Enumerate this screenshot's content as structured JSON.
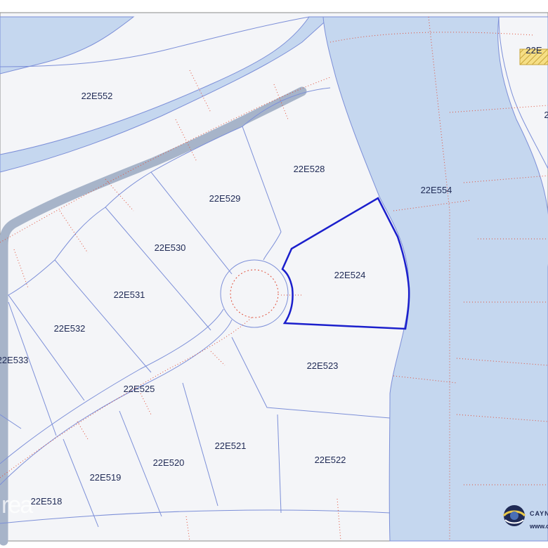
{
  "map": {
    "highlighted_parcel": "22E524",
    "colors": {
      "land": "#f4f5f8",
      "water": "#c5d7ef",
      "road": "#a7b4c9",
      "boundary": "#7c8fd8",
      "easement": "#e0503a",
      "highlight": "#1b1fcc",
      "hatch": "#e8c84a"
    },
    "parcels": [
      {
        "id": "p552",
        "label": "22E552"
      },
      {
        "id": "p528",
        "label": "22E528"
      },
      {
        "id": "p554",
        "label": "22E554"
      },
      {
        "id": "p529",
        "label": "22E529"
      },
      {
        "id": "p530",
        "label": "22E530"
      },
      {
        "id": "p524",
        "label": "22E524"
      },
      {
        "id": "p531",
        "label": "22E531"
      },
      {
        "id": "p532",
        "label": "22E532"
      },
      {
        "id": "p533",
        "label": "22E533"
      },
      {
        "id": "p523",
        "label": "22E523"
      },
      {
        "id": "p525",
        "label": "22E525"
      },
      {
        "id": "p521",
        "label": "22E521"
      },
      {
        "id": "p520",
        "label": "22E520"
      },
      {
        "id": "p522",
        "label": "22E522"
      },
      {
        "id": "p519",
        "label": "22E519"
      },
      {
        "id": "p518",
        "label": "22E518"
      }
    ],
    "partial_labels": [
      {
        "id": "top-right-partial",
        "label": "22E"
      },
      {
        "id": "right-partial",
        "label": "2"
      }
    ]
  },
  "logo": {
    "name": "CAYN",
    "url": "www.c"
  },
  "watermark": "rea"
}
